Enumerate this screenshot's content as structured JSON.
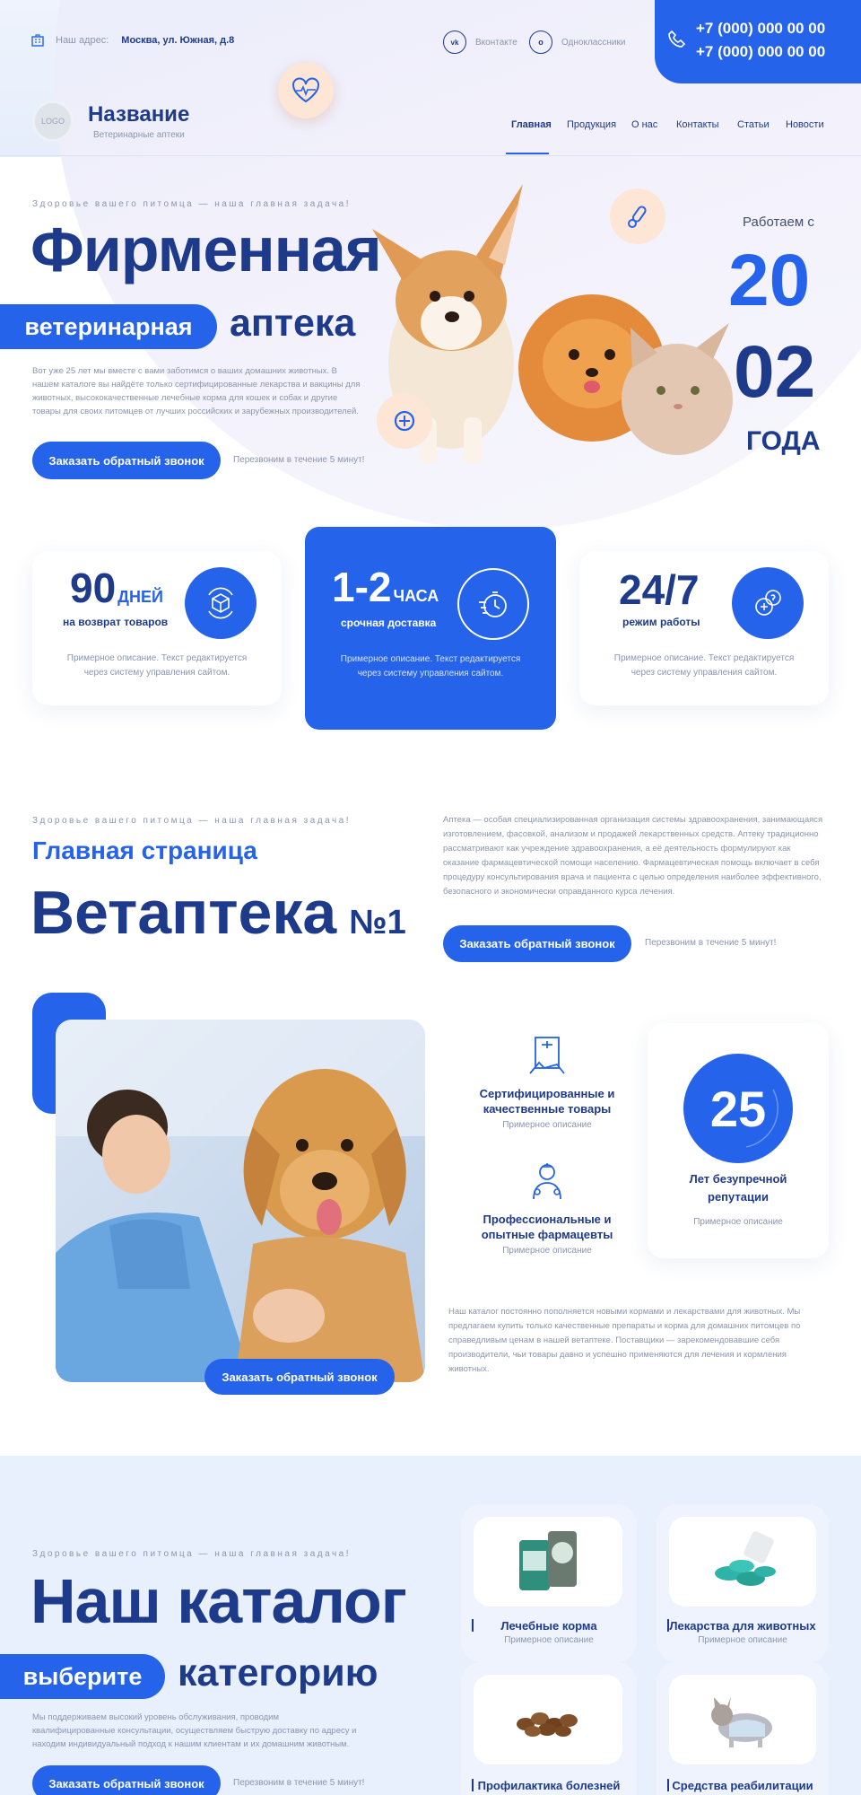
{
  "header": {
    "address_label": "Наш адрес:",
    "address": "Москва, ул. Южная, д.8",
    "social": [
      {
        "icon": "vk-icon",
        "label": "Вконтакте"
      },
      {
        "icon": "ok-icon",
        "label": "Одноклассники"
      }
    ],
    "phones": [
      "+7 (000) 000 00 00",
      "+7 (000) 000 00 00"
    ],
    "logo_text": "LOGO",
    "brand": "Название",
    "brand_sub": "Ветеринарные аптеки",
    "nav": [
      "Главная",
      "Продукция",
      "О нас",
      "Контакты",
      "Статьи",
      "Новости"
    ],
    "active_nav": "Главная"
  },
  "hero": {
    "tagline": "Здоровье вашего питомца — наша главная задача!",
    "title": "Фирменная",
    "pill": "ветеринарная",
    "word": "аптека",
    "text": "Вот уже 25 лет мы вместе с вами заботимся о ваших домашних животных. В нашем каталоге вы найдёте только сертифицированные лекарства и вакцины для животных, высококачественные лечебные корма для кошек и собак и другие товары для своих питомцев от лучших российских и зарубежных производителей.",
    "button": "Заказать обратный звонок",
    "callback_note": "Перезвоним в течение 5 минут!",
    "since_label": "Работаем с",
    "year_top": "20",
    "year_bottom": "02",
    "year_word": "ГОДА"
  },
  "features": [
    {
      "big": "90",
      "unit": "ДНЕЙ",
      "label": "на возврат товаров",
      "desc": "Примерное описание. Текст редактируется через систему управления сайтом.",
      "icon": "box-return-icon"
    },
    {
      "big": "1-2",
      "unit": "ЧАСА",
      "label": "срочная доставка",
      "desc": "Примерное описание. Текст редактируется через систему управления сайтом.",
      "icon": "fast-timer-icon"
    },
    {
      "big": "24/7",
      "unit": "",
      "label": "режим работы",
      "desc": "Примерное описание. Текст редактируется через систему управления сайтом.",
      "icon": "support-icon"
    }
  ],
  "about": {
    "tagline": "Здоровье вашего питомца — наша главная задача!",
    "subtitle": "Главная страница",
    "title": "Ветаптека",
    "title_num": "№1",
    "text": "Аптека — особая специализированная организация системы здравоохранения, занимающаяся изготовлением, фасовкой, анализом и продажей лекарственных средств. Аптеку традиционно рассматривают как учреждение здравоохранения, а её деятельность формулируют как оказание фармацевтической помощи населению. Фармацевтическая помощь включает в себя процедуру консультирования врача и пациента с целью определения наиболее эффективного, безопасного и экономически оправданного курса лечения.",
    "button": "Заказать обратный звонок",
    "callback_note": "Перезвоним в течение 5 минут!"
  },
  "vet": {
    "photo_button": "Заказать обратный звонок",
    "items": [
      {
        "icon": "certificate-icon",
        "title": "Сертифицированные и качественные товары",
        "desc": "Примерное описание"
      },
      {
        "icon": "pharmacist-icon",
        "title": "Профессиональные и опытные фармацевты",
        "desc": "Примерное описание"
      }
    ],
    "years": "25",
    "years_title": "Лет безупречной репутации",
    "years_desc": "Примерное описание",
    "text": "Наш каталог постоянно пополняется новыми кормами и лекарствами для животных. Мы предлагаем купить только качественные препараты и корма для домашних питомцев по справедливым ценам в нашей ветаптеке. Поставщики — зарекомендовавшие себя производители, чьи товары давно и успешно применяются для лечения и кормления животных."
  },
  "catalog": {
    "tagline": "Здоровье вашего питомца — наша главная задача!",
    "title": "Наш каталог",
    "pill": "выберите",
    "word": "категорию",
    "text": "Мы поддерживаем высокий уровень обслуживания, проводим квалифицированные консультации, осуществляем быструю доставку по адресу и находим индивидуальный подход к нашим клиентам и их домашним животным.",
    "button": "Заказать обратный звонок",
    "callback_note": "Перезвоним в течение 5 минут!",
    "categories": [
      {
        "title": "Лечебные корма",
        "desc": "Примерное описание"
      },
      {
        "title": "Лекарства для животных",
        "desc": "Примерное описание"
      },
      {
        "title": "Профилактика болезней",
        "desc": ""
      },
      {
        "title": "Средства реабилитации",
        "desc": ""
      }
    ]
  },
  "colors": {
    "accent": "#2563eb",
    "navy": "#1e3a8a",
    "muted": "#8a96ad",
    "bg_light": "#e8f0fd"
  }
}
